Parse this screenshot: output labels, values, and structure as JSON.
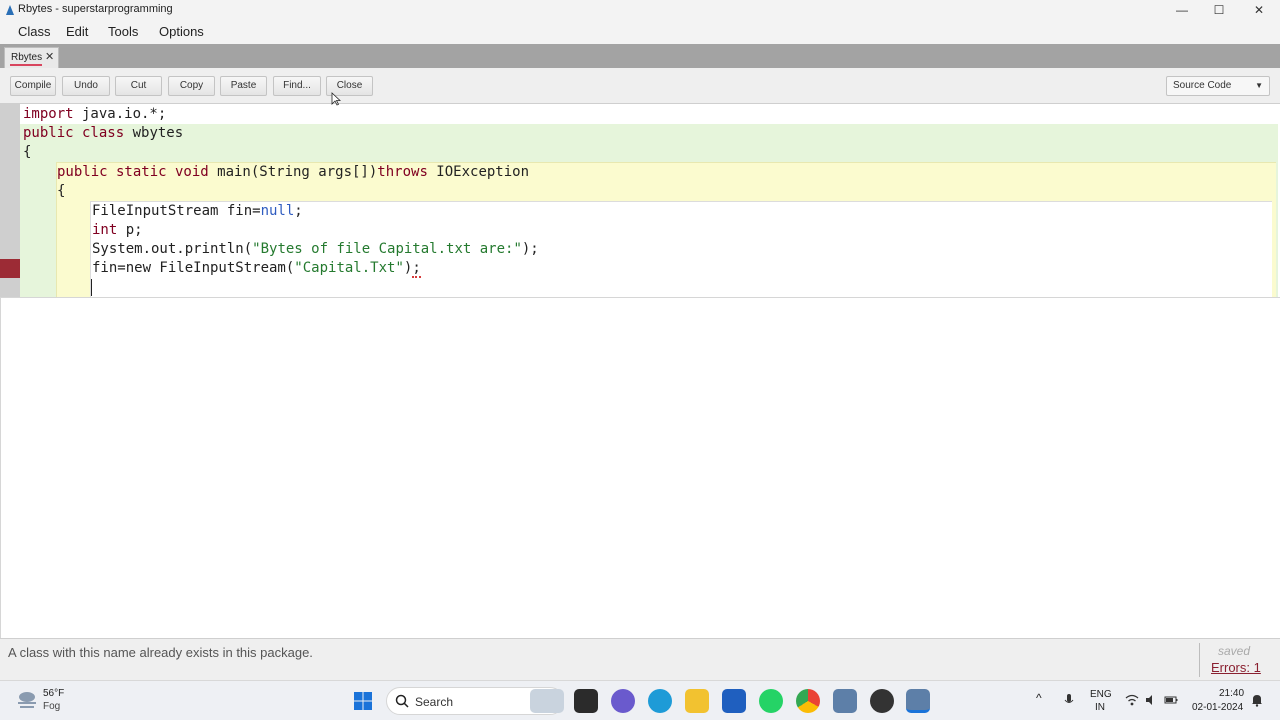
{
  "window": {
    "title": "Rbytes - superstarprogramming",
    "minimize_glyph": "—",
    "maximize_glyph": "☐",
    "close_glyph": "✕"
  },
  "menu": {
    "items": [
      {
        "label": "Class"
      },
      {
        "label": "Edit"
      },
      {
        "label": "Tools"
      },
      {
        "label": "Options"
      }
    ]
  },
  "tabs": [
    {
      "label": "Rbytes",
      "close_glyph": "✕"
    }
  ],
  "toolbar": {
    "buttons": [
      {
        "label": "Compile"
      },
      {
        "label": "Undo"
      },
      {
        "label": "Cut"
      },
      {
        "label": "Copy"
      },
      {
        "label": "Paste"
      },
      {
        "label": "Find..."
      },
      {
        "label": "Close"
      }
    ],
    "view_select": {
      "value": "Source Code",
      "arrow": "▼"
    }
  },
  "editor": {
    "lines": [
      {
        "tokens": [
          {
            "t": "import",
            "c": "kw"
          },
          {
            "t": " java.io.*;",
            "c": ""
          }
        ]
      },
      {
        "tokens": [
          {
            "t": "public class",
            "c": "kw"
          },
          {
            "t": " wbytes",
            "c": ""
          }
        ]
      },
      {
        "tokens": [
          {
            "t": "{",
            "c": ""
          }
        ]
      },
      {
        "tokens": [
          {
            "t": "public static void",
            "c": "kw"
          },
          {
            "t": " main(String args[])",
            "c": ""
          },
          {
            "t": "throws",
            "c": "kw"
          },
          {
            "t": " IOException",
            "c": ""
          }
        ]
      },
      {
        "tokens": [
          {
            "t": "{",
            "c": ""
          }
        ]
      },
      {
        "tokens": [
          {
            "t": "FileInputStream fin=",
            "c": ""
          },
          {
            "t": "null",
            "c": "lit"
          },
          {
            "t": ";",
            "c": ""
          }
        ]
      },
      {
        "tokens": [
          {
            "t": "int",
            "c": "kw"
          },
          {
            "t": " p;",
            "c": ""
          }
        ]
      },
      {
        "tokens": [
          {
            "t": "System.out.println(",
            "c": ""
          },
          {
            "t": "\"Bytes of file Capital.txt are:\"",
            "c": "str"
          },
          {
            "t": ");",
            "c": ""
          }
        ]
      },
      {
        "tokens": [
          {
            "t": "fin=new FileInputStream(",
            "c": ""
          },
          {
            "t": "\"Capital.Txt\"",
            "c": "str"
          },
          {
            "t": ")",
            "c": ""
          },
          {
            "t": ";",
            "c": "squiggle"
          }
        ]
      },
      {
        "tokens": []
      }
    ]
  },
  "status": {
    "message": "A class with this name already exists in this package.",
    "saved": "saved",
    "errors": "Errors: 1"
  },
  "taskbar": {
    "weather_temp": "56°F",
    "weather_cond": "Fog",
    "search_label": "Search",
    "lang_top": "ENG",
    "lang_bottom": "IN",
    "time": "21:40",
    "date": "02-01-2024"
  },
  "colors": {
    "class_scope": "#e6f5db",
    "method_scope": "#fbfbcf",
    "error_marker": "#9c2b35",
    "keyword": "#800021",
    "string": "#257a2f"
  }
}
